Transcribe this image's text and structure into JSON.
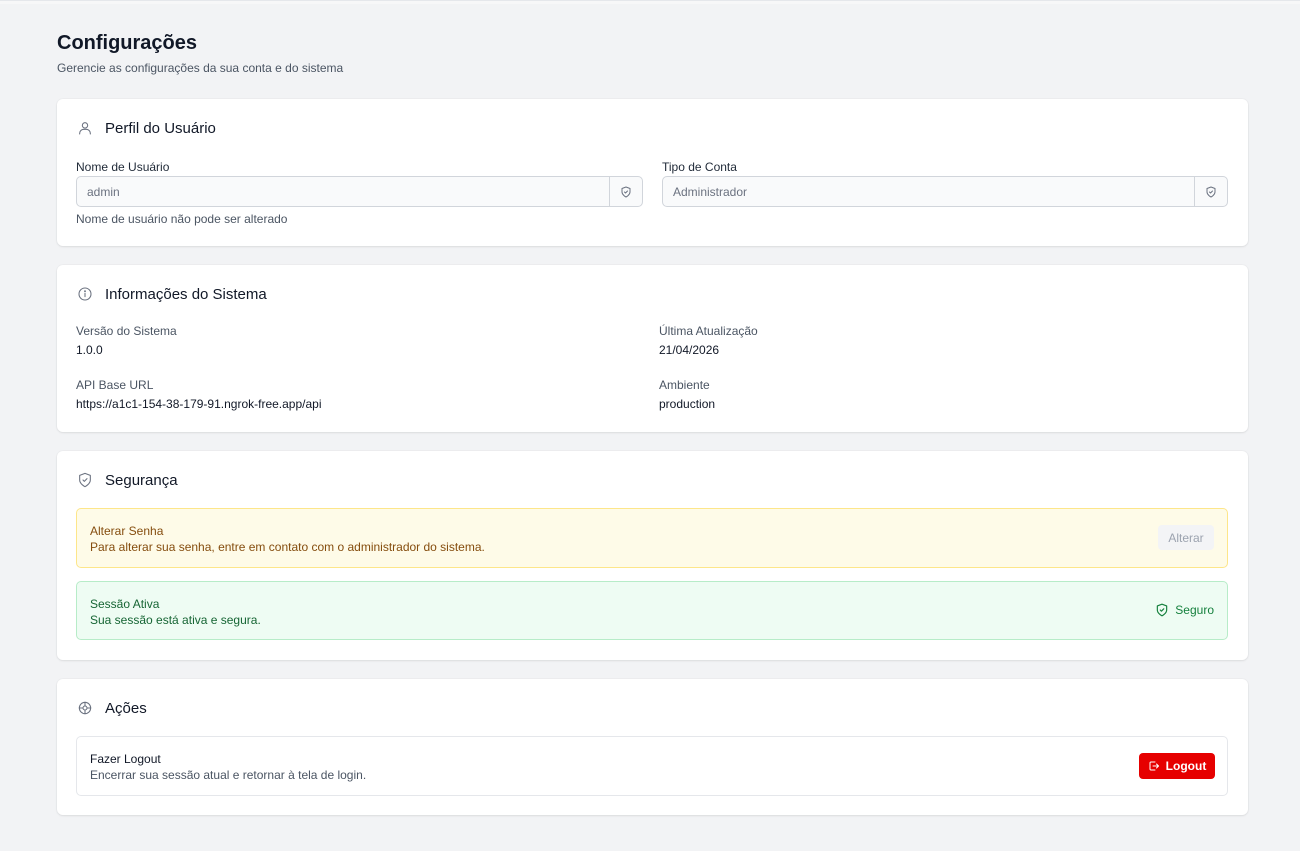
{
  "header": {
    "title": "Configurações",
    "subtitle": "Gerencie as configurações da sua conta e do sistema"
  },
  "profile": {
    "title": "Perfil do Usuário",
    "icon": "user-icon",
    "username_label": "Nome de Usuário",
    "username_value": "admin",
    "username_hint": "Nome de usuário não pode ser alterado",
    "account_type_label": "Tipo de Conta",
    "account_type_value": "Administrador"
  },
  "system": {
    "title": "Informações do Sistema",
    "icon": "info-icon",
    "version_label": "Versão do Sistema",
    "version_value": "1.0.0",
    "last_update_label": "Última Atualização",
    "last_update_value": "21/04/2026",
    "api_label": "API Base URL",
    "api_value": "https://a1c1-154-38-179-91.ngrok-free.app/api",
    "env_label": "Ambiente",
    "env_value": "production"
  },
  "security": {
    "title": "Segurança",
    "icon": "shield-check-icon",
    "password_title": "Alterar Senha",
    "password_desc": "Para alterar sua senha, entre em contato com o administrador do sistema.",
    "password_button": "Alterar",
    "session_title": "Sessão Ativa",
    "session_desc": "Sua sessão está ativa e segura.",
    "session_badge": "Seguro"
  },
  "actions": {
    "title": "Ações",
    "icon": "settings-icon",
    "logout_title": "Fazer Logout",
    "logout_desc": "Encerrar sua sessão atual e retornar à tela de login.",
    "logout_button": "Logout"
  },
  "colors": {
    "background": "#f2f3f5",
    "danger": "#e60000",
    "warning_bg": "#fefbe8",
    "success_bg": "#eefcf3"
  }
}
